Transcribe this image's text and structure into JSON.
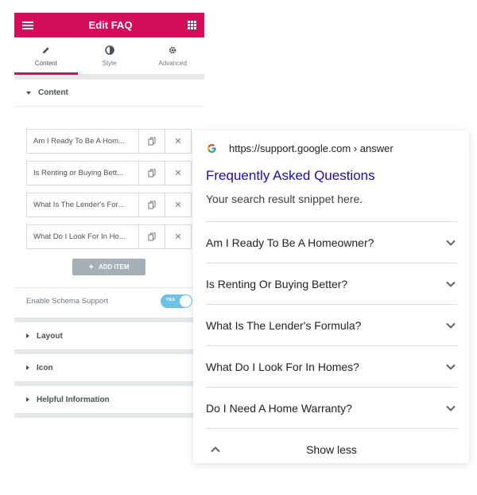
{
  "panel": {
    "title": "Edit FAQ",
    "tabs": [
      {
        "label": "Content",
        "icon": "pencil-icon",
        "active": true
      },
      {
        "label": "Style",
        "icon": "half-circle-icon",
        "active": false
      },
      {
        "label": "Advanced",
        "icon": "gear-icon",
        "active": false
      }
    ],
    "section_title": "Content",
    "items": [
      {
        "title": "Am I Ready To Be A Hom..."
      },
      {
        "title": "Is Renting or Buying Bett..."
      },
      {
        "title": "What Is The Lender's For..."
      },
      {
        "title": "What Do I Look For In Ho..."
      }
    ],
    "add_item_label": "ADD ITEM",
    "schema_label": "Enable Schema Support",
    "schema_toggle": "YES",
    "closed_sections": [
      "Layout",
      "Icon",
      "Helpful Information"
    ],
    "accent": "#d30c5c"
  },
  "card": {
    "url": "https://support.google.com › answer",
    "title": "Frequently Asked Questions",
    "snippet": "Your search result snippet here.",
    "questions": [
      "Am I Ready To Be A Homeowner?",
      "Is Renting Or Buying Better?",
      "What Is The Lender's Formula?",
      "What Do I Look For In Homes?",
      "Do I Need A Home Warranty?"
    ],
    "show_less": "Show less",
    "link_color": "#1a0dab"
  }
}
